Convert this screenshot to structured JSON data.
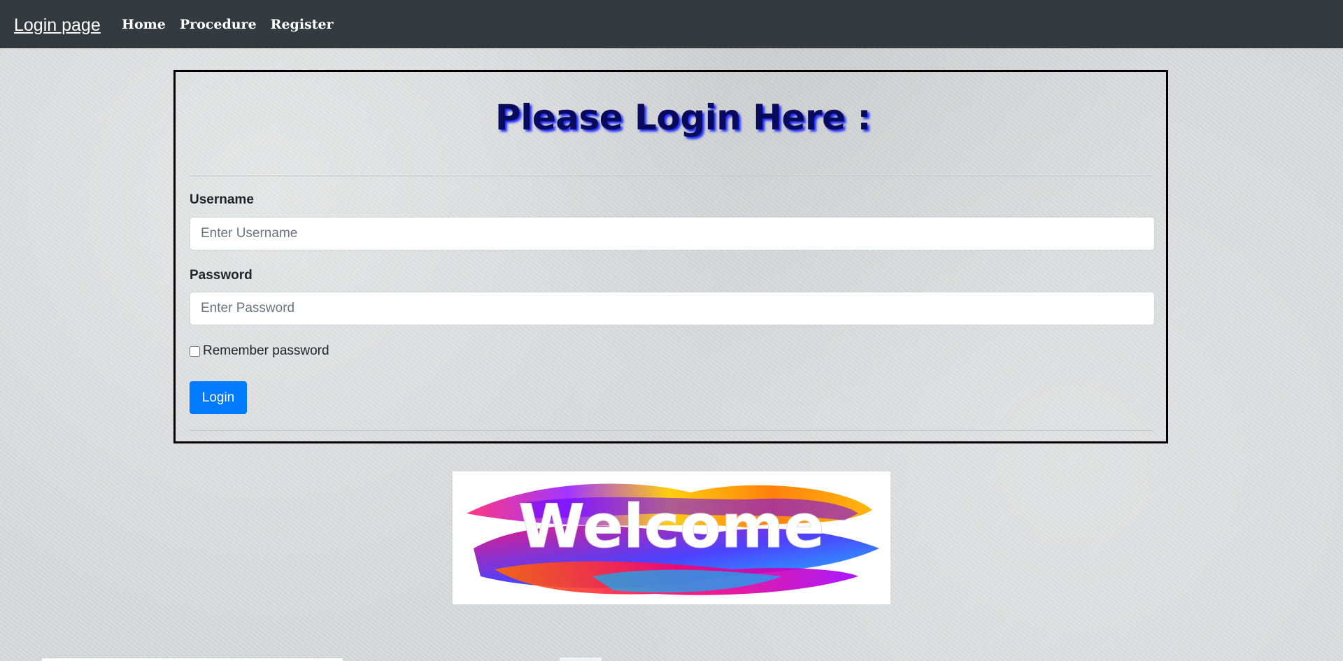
{
  "navbar": {
    "brand": "Login page",
    "links": [
      "Home",
      "Procedure",
      "Register"
    ]
  },
  "login_form": {
    "title": "Please Login Here :",
    "username_label": "Username",
    "username_placeholder": "Enter Username",
    "username_value": "",
    "password_label": "Password",
    "password_placeholder": "Enter Password",
    "password_value": "",
    "remember_label": "Remember password",
    "remember_checked": false,
    "login_button": "Login"
  },
  "welcome_image": {
    "text": "Welcome"
  },
  "colors": {
    "navbar_bg": "#343a40",
    "primary_button": "#007bff",
    "title_color": "#0a0a5c",
    "title_shadow": "#1a2cff"
  }
}
